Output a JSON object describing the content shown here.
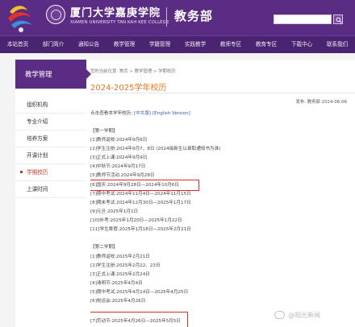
{
  "header": {
    "university_cn": "厦门大学嘉庚学院",
    "university_en": "XIAMEN UNIVERSITY TAN KAH KEE COLLEGE",
    "department": "教务部",
    "search_placeholder": ""
  },
  "nav": {
    "items": [
      "本站首页",
      "部门简介",
      "通知公告",
      "教学管理",
      "学籍管理",
      "实践教学",
      "教师专区",
      "教育专区",
      "下载中心",
      "联系我们"
    ]
  },
  "sidebar": {
    "title": "教学管理",
    "items": [
      {
        "label": "组织机构",
        "active": false
      },
      {
        "label": "专业介绍",
        "active": false
      },
      {
        "label": "培养方案",
        "active": false
      },
      {
        "label": "开课计划",
        "active": false
      },
      {
        "label": "学期校历",
        "active": true
      },
      {
        "label": "上课时间",
        "active": false
      }
    ]
  },
  "main": {
    "breadcrumb": "您的当前位置: 首页 > 教学管理 > 学期校历",
    "title": "2024-2025学年校历",
    "meta": "发布: 教务部  2024-06-06",
    "intro_prefix": "点击查看本学年校历:",
    "intro_link_cn": "[中文版]",
    "intro_link_en": "[English Version]",
    "semester1": {
      "heading": "【第一学期】",
      "lines": [
        "[1]教师返校:2024年9月6日",
        "[2]学生注册:2024年9月7、8日 (2024级新生以录取通知书为准)",
        "[3]正式上课:2024年9月9日",
        "[4]中秋节:2024年9月17日",
        "[5]教师节活动:2024年9月28日",
        "[6]国庆:2024年9月28日—2024年10月6日",
        "[7]期中考试:2024年11月4日—2024年11月15日",
        "[8]期末考试:2024年12月30日—2025年1月17日",
        "[9]元旦:2025年1月1日",
        "[10]补考:2025年1月20日—2025年1月22日",
        "[11]学生寒假:2025年1月18日—2025年2月21日"
      ]
    },
    "semester2": {
      "heading": "【第二学期】",
      "lines": [
        "[1]教师返校:2025年2月21日",
        "[2]学生注册:2025年2月22、23日",
        "[3]正式上课:2025年2月24日",
        "[4]清明节:2025年4月4日",
        "[5]期中考试:2025年4月14日—2025年4月25日",
        "[6]校运会:2025年4月26日",
        "[7]劳动节:2025年4月26日—2025年5月5日"
      ]
    }
  },
  "watermark": "@阳光新闻",
  "colors": {
    "brand_purple": "#5b2c83",
    "title_orange": "#e07a1f",
    "highlight_red": "#e02a2a",
    "active_red": "#c0392b"
  }
}
